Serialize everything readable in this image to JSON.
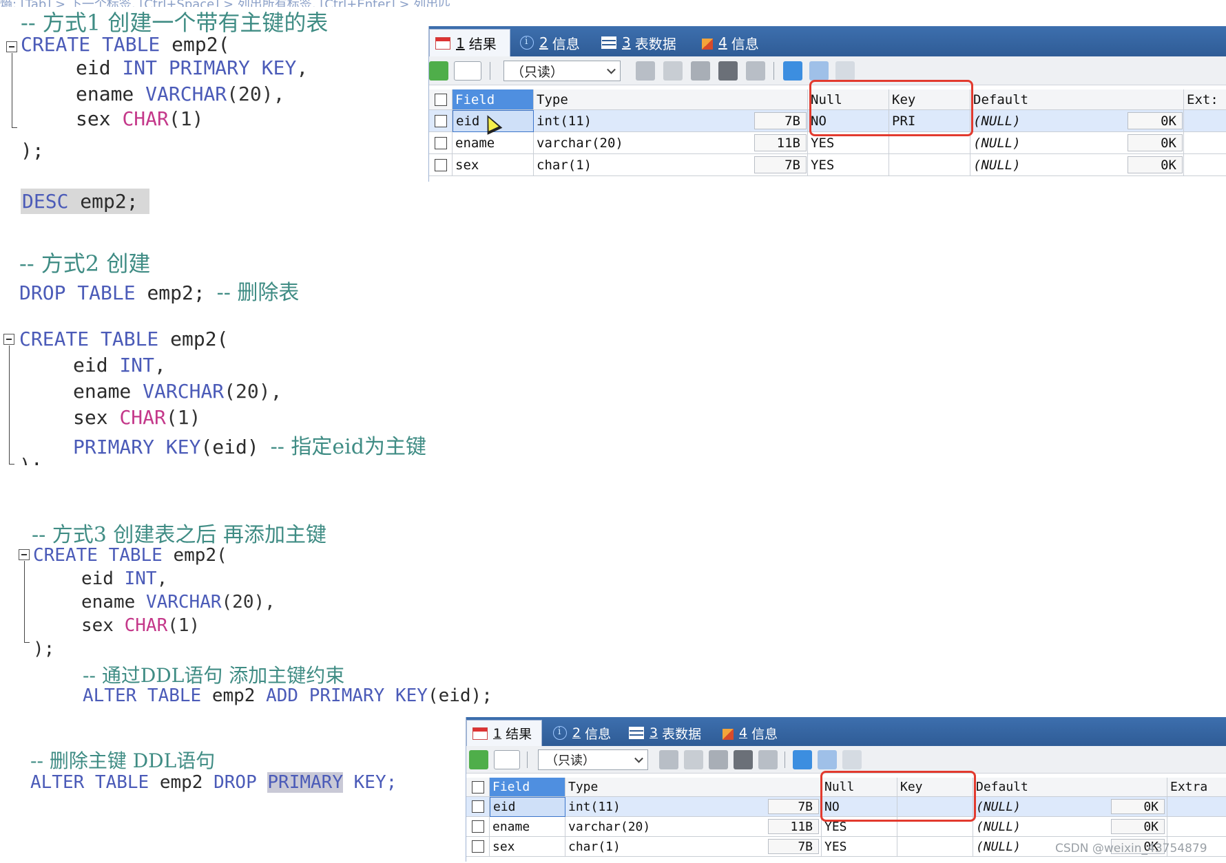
{
  "editor": {
    "breadcrumb": "熵: [Tab] > 下一个标签, [Ctrl+Space] > 列出所有标签, [Ctrl+Enter] > 列出匹",
    "block1": {
      "comment": "-- 方式1 创建一个带有主键的表",
      "create_kw": "CREATE TABLE",
      "table": "emp2(",
      "col1_name": "eid",
      "col1_type": "INT PRIMARY KEY",
      "col1_end": ",",
      "col2_name": "ename",
      "col2_type": "VARCHAR",
      "col2_args": "(20),",
      "col3_name": "sex",
      "col3_type": "CHAR",
      "col3_args": "(1)",
      "close": ");",
      "desc_kw": "DESC",
      "desc_rest": "emp2;"
    },
    "block2": {
      "comment": "-- 方式2 创建",
      "drop_kw": "DROP TABLE",
      "drop_rest": "emp2;",
      "drop_comment": "-- 删除表",
      "create_kw": "CREATE TABLE",
      "table": "emp2(",
      "col1_name": "eid",
      "col1_type": "INT",
      "col1_end": ",",
      "col2_name": "ename",
      "col2_type": "VARCHAR",
      "col2_args": "(20),",
      "col3_name": "sex",
      "col3_type": "CHAR",
      "col3_args": "(1)",
      "pk_kw": "PRIMARY KEY",
      "pk_args": "(eid)",
      "pk_comment": "-- 指定eid为主键",
      "close": ");"
    },
    "block3": {
      "comment": "-- 方式3 创建表之后 再添加主键",
      "create_kw": "CREATE TABLE",
      "table": "emp2(",
      "col1_name": "eid",
      "col1_type": "INT",
      "col1_end": ",",
      "col2_name": "ename",
      "col2_type": "VARCHAR",
      "col2_args": "(20),",
      "col3_name": "sex",
      "col3_type": "CHAR",
      "col3_args": "(1)",
      "close": ");",
      "ddl_comment": "-- 通过DDL语句 添加主键约束",
      "alter_kw": "ALTER TABLE",
      "alter_table": "emp2",
      "alter_add": "ADD PRIMARY KEY",
      "alter_args": "(eid);"
    },
    "block4": {
      "comment": "-- 删除主键 DDL语句",
      "alter_kw": "ALTER TABLE",
      "alter_table": "emp2",
      "drop_kw": "DROP",
      "primary_kw": "PRIMARY",
      "key_kw": "KEY;"
    }
  },
  "result_top": {
    "tabs": [
      {
        "num": "1",
        "label": "结果"
      },
      {
        "num": "2",
        "label": "信息"
      },
      {
        "num": "3",
        "label": "表数据"
      },
      {
        "num": "4",
        "label": "信息"
      }
    ],
    "readonly_select": "（只读）",
    "columns": [
      "Field",
      "Type",
      "Null",
      "Key",
      "Default",
      "Ext:"
    ],
    "rows": [
      {
        "field": "eid",
        "type": "int(11)",
        "size": "7B",
        "null": "NO",
        "key": "PRI",
        "default": "(NULL)",
        "default_size": "0K"
      },
      {
        "field": "ename",
        "type": "varchar(20)",
        "size": "11B",
        "null": "YES",
        "key": "",
        "default": "(NULL)",
        "default_size": "0K"
      },
      {
        "field": "sex",
        "type": "char(1)",
        "size": "7B",
        "null": "YES",
        "key": "",
        "default": "(NULL)",
        "default_size": "0K"
      }
    ]
  },
  "result_bottom": {
    "tabs": [
      {
        "num": "1",
        "label": "结果"
      },
      {
        "num": "2",
        "label": "信息"
      },
      {
        "num": "3",
        "label": "表数据"
      },
      {
        "num": "4",
        "label": "信息"
      }
    ],
    "readonly_select": "（只读）",
    "columns": [
      "Field",
      "Type",
      "Null",
      "Key",
      "Default",
      "Extra"
    ],
    "rows": [
      {
        "field": "eid",
        "type": "int(11)",
        "size": "7B",
        "null": "NO",
        "key": "",
        "default": "(NULL)",
        "default_size": "0K"
      },
      {
        "field": "ename",
        "type": "varchar(20)",
        "size": "11B",
        "null": "YES",
        "key": "",
        "default": "(NULL)",
        "default_size": "0K"
      },
      {
        "field": "sex",
        "type": "char(1)",
        "size": "7B",
        "null": "YES",
        "key": "",
        "default": "(NULL)",
        "default_size": "0K"
      }
    ]
  },
  "watermark": "CSDN @weixin_43754879",
  "colors": {
    "keyword": "#4b5bb8",
    "char_type": "#c4388a",
    "comment": "#3f8c84",
    "tabbar": "#2f5c96",
    "highlight_box": "#e23a2e"
  }
}
